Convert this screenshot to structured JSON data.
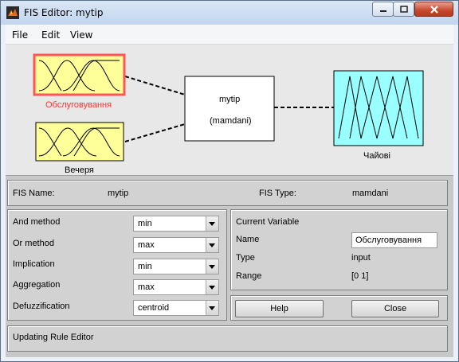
{
  "window": {
    "title": "FIS Editor: mytip"
  },
  "menu": {
    "file": "File",
    "edit": "Edit",
    "view": "View"
  },
  "diagram": {
    "input1_label": "Обслуговування",
    "input2_label": "Вечеря",
    "system_name": "mytip",
    "system_type": "(mamdani)",
    "output_label": "Чайові",
    "colors": {
      "input_fill": "#ffff99",
      "output_fill": "#99ffff",
      "selected_border": "#ff5555",
      "selected_label": "#ff3333"
    }
  },
  "info": {
    "fis_name_label": "FIS Name:",
    "fis_name_value": "mytip",
    "fis_type_label": "FIS Type:",
    "fis_type_value": "mamdani"
  },
  "methods": {
    "and_label": "And method",
    "and_value": "min",
    "or_label": "Or method",
    "or_value": "max",
    "implication_label": "Implication",
    "implication_value": "min",
    "aggregation_label": "Aggregation",
    "aggregation_value": "max",
    "defuzz_label": "Defuzzification",
    "defuzz_value": "centroid"
  },
  "current_variable": {
    "title": "Current Variable",
    "name_label": "Name",
    "name_value": "Обслуговування",
    "type_label": "Type",
    "type_value": "input",
    "range_label": "Range",
    "range_value": "[0 1]"
  },
  "buttons": {
    "help": "Help",
    "close": "Close"
  },
  "status": "Updating Rule Editor"
}
